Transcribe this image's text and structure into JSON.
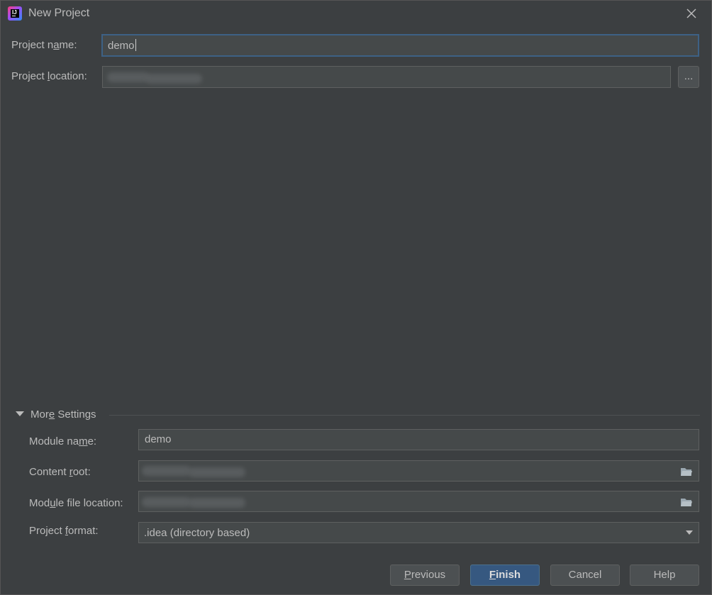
{
  "window": {
    "title": "New Project",
    "app_icon": "intellij-idea-icon",
    "close_icon": "close-icon"
  },
  "project": {
    "name_label_pre": "Project n",
    "name_label_mnemonic": "a",
    "name_label_post": "me:",
    "name_value": "demo",
    "location_label_pre": "Project ",
    "location_label_mnemonic": "l",
    "location_label_post": "ocation:",
    "location_value_redacted": true,
    "browse_label": "..."
  },
  "more_settings": {
    "title_pre": "Mor",
    "title_mnemonic": "e",
    "title_post": " Settings",
    "expanded": true,
    "module_name_label_pre": "Module na",
    "module_name_label_mnemonic": "m",
    "module_name_label_post": "e:",
    "module_name_value": "demo",
    "content_root_label_pre": "Content ",
    "content_root_label_mnemonic": "r",
    "content_root_label_post": "oot:",
    "module_file_location_label_pre": "Mod",
    "module_file_location_label_mnemonic": "u",
    "module_file_location_label_post": "le file location:",
    "project_format_label_pre": "Project ",
    "project_format_label_mnemonic": "f",
    "project_format_label_post": "ormat:",
    "project_format_value": ".idea (directory based)"
  },
  "buttons": {
    "previous_mnemonic": "P",
    "previous_rest": "revious",
    "finish_mnemonic": "F",
    "finish_rest": "inish",
    "cancel": "Cancel",
    "help": "Help"
  },
  "colors": {
    "background": "#3c3f41",
    "field_bg": "#45494a",
    "focus_border": "#3d6185",
    "primary_button": "#365880",
    "text": "#bbbbbb"
  }
}
